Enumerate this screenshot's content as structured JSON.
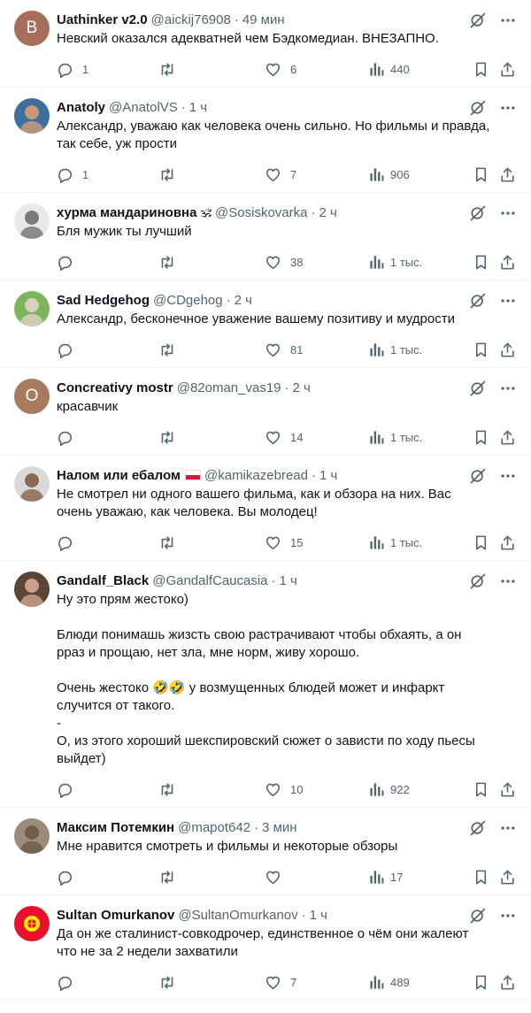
{
  "colors": {
    "text": "#0f1419",
    "secondary": "#536471",
    "divider": "#eff3f4"
  },
  "tweets": [
    {
      "name": "Uathinker v2.0",
      "handle": "@aickij76908",
      "time": "49 мин",
      "avatar": {
        "type": "letter",
        "letter": "B",
        "color": "#a86e5c"
      },
      "lines": [
        "Невский оказался адекватней чем Бэдкомедиан. ВНЕЗАПНО."
      ],
      "replies": "1",
      "retweets": "",
      "likes": "6",
      "views": "440"
    },
    {
      "name": "Anatoly",
      "handle": "@AnatolVS",
      "time": "1 ч",
      "avatar": {
        "type": "photo",
        "color": "#3d6e9e",
        "face": "#c99a7a"
      },
      "lines": [
        "Александр, уважаю как человека очень сильно. Но фильмы и правда, так себе, уж прости"
      ],
      "replies": "1",
      "retweets": "",
      "likes": "7",
      "views": "906"
    },
    {
      "name": "хурма мандариновна",
      "emoji": "🕉",
      "handle": "@Sosiskovarka",
      "time": "2 ч",
      "avatar": {
        "type": "photo",
        "color": "#e9e9e9",
        "face": "#7a7a7a"
      },
      "lines": [
        "Бля мужик ты лучший"
      ],
      "replies": "",
      "retweets": "",
      "likes": "38",
      "views": "1 тыс."
    },
    {
      "name": "Sad Hedgehog",
      "handle": "@CDgehog",
      "time": "2 ч",
      "avatar": {
        "type": "photo",
        "color": "#7db65a",
        "face": "#d8cfc2"
      },
      "lines": [
        "Александр, бесконечное уважение вашему позитиву и мудрости"
      ],
      "replies": "",
      "retweets": "",
      "likes": "81",
      "views": "1 тыс."
    },
    {
      "name": "Concreativy mostr",
      "handle": "@82oman_vas19",
      "time": "2 ч",
      "avatar": {
        "type": "letter",
        "letter": "O",
        "color": "#a87a5e"
      },
      "lines": [
        "красавчик"
      ],
      "replies": "",
      "retweets": "",
      "likes": "14",
      "views": "1 тыс."
    },
    {
      "name": "Налом или ебалом",
      "flag": true,
      "handle": "@kamikazebread",
      "time": "1 ч",
      "avatar": {
        "type": "photo",
        "color": "#d9d9d9",
        "face": "#8a6a55"
      },
      "lines": [
        "Не смотрел ни одного вашего фильма, как и обзора на них. Вас очень уважаю, как человека. Вы молодец!"
      ],
      "replies": "",
      "retweets": "",
      "likes": "15",
      "views": "1 тыс."
    },
    {
      "name": "Gandalf_Black",
      "handle": "@GandalfCaucasia",
      "time": "1 ч",
      "avatar": {
        "type": "photo",
        "color": "#5a4636",
        "face": "#c9a088"
      },
      "lines": [
        "Ну это прям жестоко)",
        "",
        "Блюди понимашь жизсть свою растрачивают чтобы обхаять, а он рраз и прощаю, нет зла, мне норм, живу хорошо.",
        "",
        "Очень жестоко 🤣🤣 у возмущенных блюдей может и инфаркт случится от такого.",
        "-",
        "О, из этого хороший шекспировский сюжет о зависти по ходу пьесы выйдет)"
      ],
      "replies": "",
      "retweets": "",
      "likes": "10",
      "views": "922"
    },
    {
      "name": "Максим Потемкин",
      "handle": "@mapot642",
      "time": "3 мин",
      "avatar": {
        "type": "photo",
        "color": "#9a8b7a",
        "face": "#6e5e4e"
      },
      "lines": [
        "Мне нравится смотреть и фильмы и некоторые обзоры"
      ],
      "replies": "",
      "retweets": "",
      "likes": "",
      "views": "17"
    },
    {
      "name": "Sultan Omurkanov",
      "handle": "@SultanOmurkanov",
      "time": "1 ч",
      "avatar": {
        "type": "kg",
        "color": "#e8112d",
        "face": "#ffef00"
      },
      "lines": [
        "Да он же сталинист-совкодрочер, единственное о чём они жалеют что не за 2 недели захватили"
      ],
      "replies": "",
      "retweets": "",
      "likes": "7",
      "views": "489"
    }
  ]
}
